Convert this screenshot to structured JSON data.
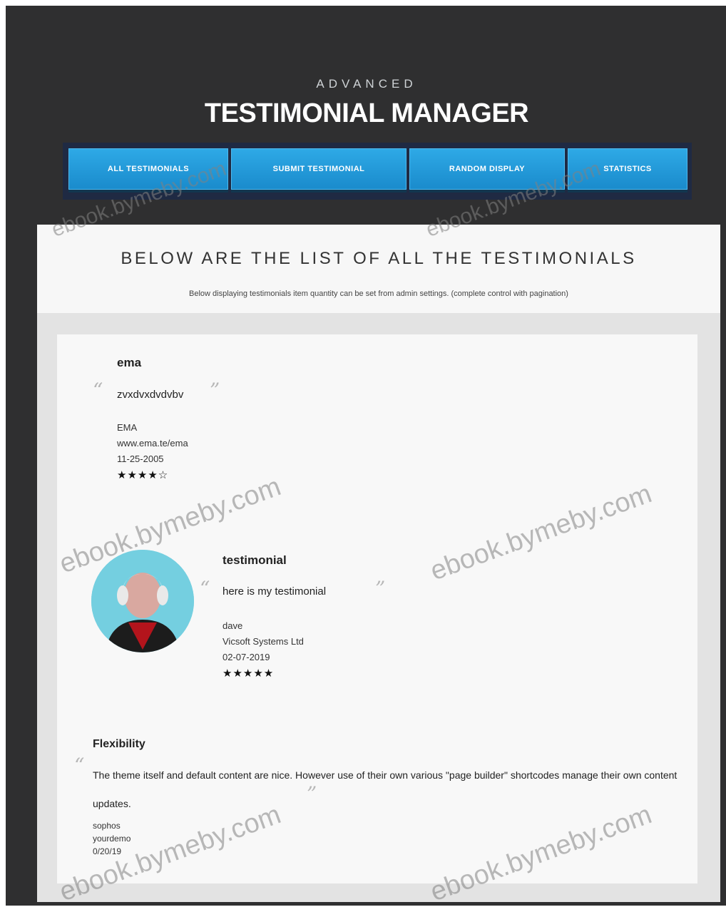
{
  "header": {
    "subtitle": "ADVANCED",
    "title": "TESTIMONIAL MANAGER"
  },
  "nav": {
    "items": [
      {
        "label": "All Testimonials"
      },
      {
        "label": "Submit Testimonial"
      },
      {
        "label": "Random Display"
      },
      {
        "label": "Statistics"
      }
    ]
  },
  "panel": {
    "title": "BELOW ARE THE LIST OF ALL THE TESTIMONIALS",
    "note": "Below displaying testimonials item quantity can be set from admin settings. (complete control with pagination)"
  },
  "testimonials": [
    {
      "title": "ema",
      "text": "zvxdvxdvdvbv",
      "author": "EMA",
      "company": "www.ema.te/ema",
      "date": "11-25-2005",
      "stars": "★★★★☆"
    },
    {
      "title": "testimonial",
      "text": "here is my testimonial",
      "author": "dave",
      "company": "Vicsoft Systems Ltd",
      "date": "02-07-2019",
      "stars": "★★★★★"
    },
    {
      "title": "Flexibility",
      "text": "The theme itself and default content are nice. However use of their own various \"page builder\" shortcodes manage their own content updates.",
      "author": "sophos",
      "company": "yourdemo",
      "date": "0/20/19"
    }
  ],
  "watermark": "ebook.bymeby.com",
  "colors": {
    "background": "#2f2f30",
    "nav_button": "#1f9ad9",
    "panel": "#e3e3e3"
  }
}
